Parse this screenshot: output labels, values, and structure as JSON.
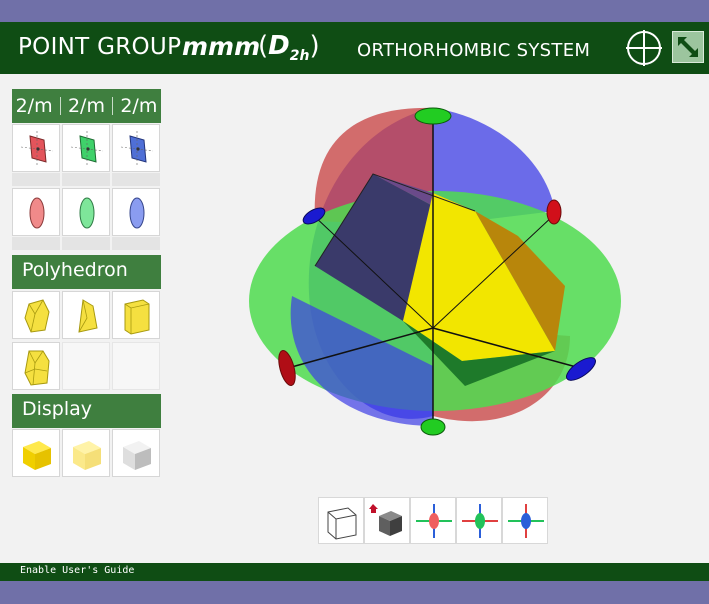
{
  "header": {
    "title": "POINT GROUP",
    "symbol": "mmm",
    "schoenflies_main": "D",
    "schoenflies_sub": "2h",
    "system": "ORTHORHOMBIC SYSTEM",
    "icons": [
      "crosshair-icon",
      "expand-icon"
    ]
  },
  "symmetry": {
    "labels": [
      "2/m",
      "2/m",
      "2/m"
    ],
    "plane_colors": [
      "#e3545b",
      "#3fd16a",
      "#4f6fd6"
    ]
  },
  "sections": {
    "polyhedron": "Polyhedron",
    "display": "Display"
  },
  "viewer": {
    "ellipse_colors": {
      "red": "#c94a4a",
      "blue": "#3d3de6",
      "green": "#4fdc4f"
    },
    "solid_color": "#f2e600"
  },
  "toolbar": {
    "tools": [
      "wireframe-cube-icon",
      "home-cube-icon",
      "axis-red-icon",
      "axis-green-icon",
      "axis-blue-icon"
    ]
  },
  "footer": {
    "guide_label": "Enable User's Guide"
  }
}
